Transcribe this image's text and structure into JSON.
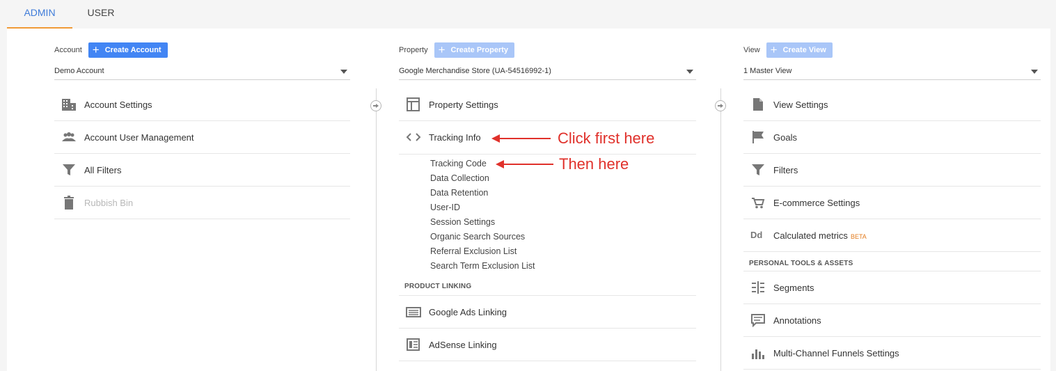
{
  "tabs": {
    "admin": "ADMIN",
    "user": "USER"
  },
  "account": {
    "label": "Account",
    "create_label": "Create Account",
    "selected": "Demo Account",
    "items": [
      {
        "label": "Account Settings",
        "icon": "building-icon"
      },
      {
        "label": "Account User Management",
        "icon": "people-icon"
      },
      {
        "label": "All Filters",
        "icon": "filter-icon"
      },
      {
        "label": "Rubbish Bin",
        "icon": "trash-icon"
      }
    ]
  },
  "property": {
    "label": "Property",
    "create_label": "Create Property",
    "selected": "Google Merchandise Store (UA-54516992-1)",
    "items": [
      {
        "label": "Property Settings",
        "icon": "window-icon"
      },
      {
        "label": "Tracking Info",
        "icon": "code-icon"
      }
    ],
    "tracking_subitems": [
      "Tracking Code",
      "Data Collection",
      "Data Retention",
      "User-ID",
      "Session Settings",
      "Organic Search Sources",
      "Referral Exclusion List",
      "Search Term Exclusion List"
    ],
    "product_linking_heading": "PRODUCT LINKING",
    "linking_items": [
      {
        "label": "Google Ads Linking",
        "icon": "ads-icon"
      },
      {
        "label": "AdSense Linking",
        "icon": "adsense-icon"
      }
    ]
  },
  "view": {
    "label": "View",
    "create_label": "Create View",
    "selected": "1 Master View",
    "items": [
      {
        "label": "View Settings",
        "icon": "document-icon"
      },
      {
        "label": "Goals",
        "icon": "flag-icon"
      },
      {
        "label": "Filters",
        "icon": "filter-icon"
      },
      {
        "label": "E-commerce Settings",
        "icon": "cart-icon"
      },
      {
        "label": "Calculated metrics",
        "icon": "dd-icon",
        "badge": "BETA"
      }
    ],
    "personal_heading": "PERSONAL TOOLS & ASSETS",
    "personal_items": [
      {
        "label": "Segments",
        "icon": "segments-icon"
      },
      {
        "label": "Annotations",
        "icon": "comment-icon"
      },
      {
        "label": "Multi-Channel Funnels Settings",
        "icon": "bar-chart-icon"
      }
    ]
  },
  "annotations": {
    "first": "Click first here",
    "second": "Then here"
  },
  "colors": {
    "accent": "#4285f4",
    "tab_underline": "#f09a36",
    "annotation": "#e0312b"
  }
}
